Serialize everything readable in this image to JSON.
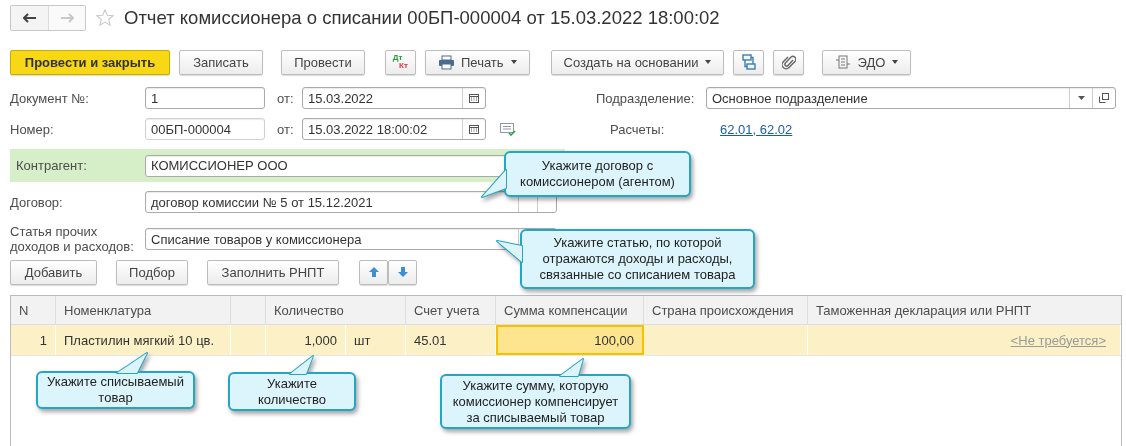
{
  "nav": {
    "back_disabled": false,
    "forward_disabled": true
  },
  "window": {
    "title": "Отчет комиссионера о списании 00БП-000004 от 15.03.2022 18:00:02",
    "favorite": false
  },
  "toolbar": [
    {
      "kind": "primary",
      "label": "Провести и закрыть"
    },
    {
      "kind": "plain",
      "label": "Записать"
    },
    {
      "kind": "plain",
      "label": "Провести"
    },
    {
      "kind": "dtkt",
      "label_top": "Дт",
      "label_bottom": "Кт"
    },
    {
      "kind": "print-menu",
      "label": "Печать"
    },
    {
      "kind": "menu",
      "label": "Создать на основании"
    },
    {
      "kind": "structure"
    },
    {
      "kind": "attach"
    },
    {
      "kind": "edo-menu",
      "label": "ЭДО"
    }
  ],
  "document_number": {
    "label": "Документ №:",
    "value": "1",
    "date_label": "от:",
    "date": "15.03.2022"
  },
  "number": {
    "label": "Номер:",
    "value": "00БП-000004",
    "date_label": "от:",
    "date": "15.03.2022 18:00:02"
  },
  "division": {
    "label": "Подразделение:",
    "value": "Основное подразделение"
  },
  "settlements": {
    "label": "Расчеты:",
    "link": "62.01, 62.02"
  },
  "counterparty": {
    "label": "Контрагент:",
    "value": "КОМИССИОНЕР ООО"
  },
  "contract": {
    "label": "Договор:",
    "value": "договор комиссии № 5 от 15.12.2021"
  },
  "expense_item": {
    "label": "Статья прочих доходов и расходов:",
    "value": "Списание товаров у комиссионера"
  },
  "table_buttons": [
    "Добавить",
    "Подбор",
    "Заполнить РНПТ"
  ],
  "table": {
    "columns": [
      "N",
      "Номенклатура",
      "Количество",
      "Счет учета",
      "Сумма компенсации",
      "Страна происхождения",
      "Таможенная декларация или РНПТ"
    ],
    "rows": [
      {
        "selected": true,
        "n": "1",
        "nomenclature": "Пластилин мягкий 10 цв.",
        "quantity": "1,000",
        "unit": "шт",
        "account": "45.01",
        "amount": "100,00",
        "amount_focused": true,
        "declaration": "<Не требуется>"
      }
    ]
  },
  "hints": [
    "Укажите договор с\nкомиссионером (агентом)",
    "Укажите статью, по которой\nотражаются доходы и расходы,\nсвязанные со списанием товара",
    "Укажите списываемый\nтовар",
    "Укажите\nколичество",
    "Укажите сумму, которую\nкомиссионер компенсирует\nза списываемый товар"
  ]
}
